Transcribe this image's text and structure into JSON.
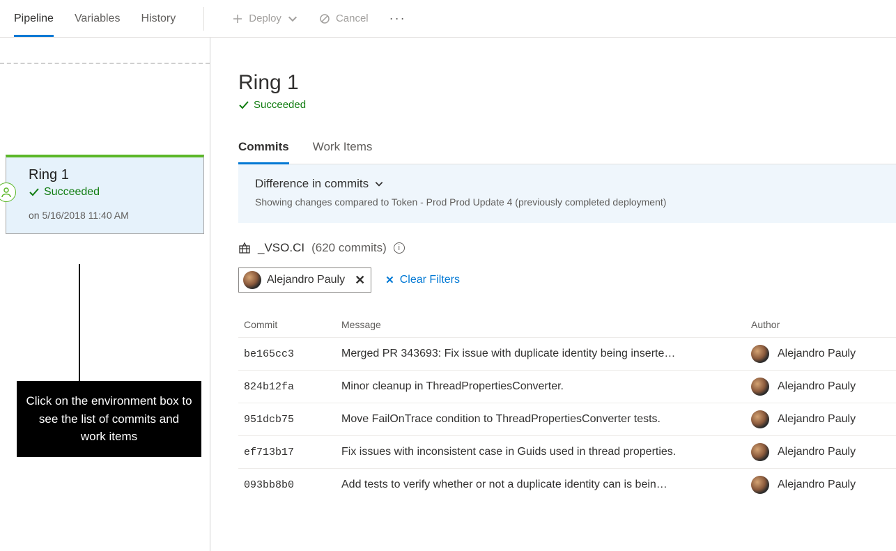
{
  "topTabs": {
    "pipeline": "Pipeline",
    "variables": "Variables",
    "history": "History"
  },
  "toolbar": {
    "deploy": "Deploy",
    "cancel": "Cancel"
  },
  "envCard": {
    "title": "Ring 1",
    "status": "Succeeded",
    "date": "on 5/16/2018 11:40 AM"
  },
  "callout": "Click on the environment box to see the list of commits and work items",
  "detail": {
    "title": "Ring 1",
    "status": "Succeeded"
  },
  "subTabs": {
    "commits": "Commits",
    "workItems": "Work Items"
  },
  "diffBanner": {
    "title": "Difference in commits",
    "subtitle": "Showing changes compared to Token - Prod Prod Update 4 (previously completed deployment)"
  },
  "repo": {
    "name": "_VSO.CI",
    "count": "(620 commits)"
  },
  "filter": {
    "author": "Alejandro Pauly",
    "clear": "Clear Filters"
  },
  "table": {
    "headers": {
      "commit": "Commit",
      "message": "Message",
      "author": "Author"
    }
  },
  "commits": [
    {
      "hash": "be165cc3",
      "msg": "Merged PR 343693: Fix issue with duplicate identity being inserte…",
      "author": "Alejandro Pauly"
    },
    {
      "hash": "824b12fa",
      "msg": "Minor cleanup in ThreadPropertiesConverter.",
      "author": "Alejandro Pauly"
    },
    {
      "hash": "951dcb75",
      "msg": "Move FailOnTrace condition to ThreadPropertiesConverter tests.",
      "author": "Alejandro Pauly"
    },
    {
      "hash": "ef713b17",
      "msg": "Fix issues with inconsistent case in Guids used in thread properties.",
      "author": "Alejandro Pauly"
    },
    {
      "hash": "093bb8b0",
      "msg": "Add tests to verify whether or not a duplicate identity can is bein…",
      "author": "Alejandro Pauly"
    }
  ]
}
